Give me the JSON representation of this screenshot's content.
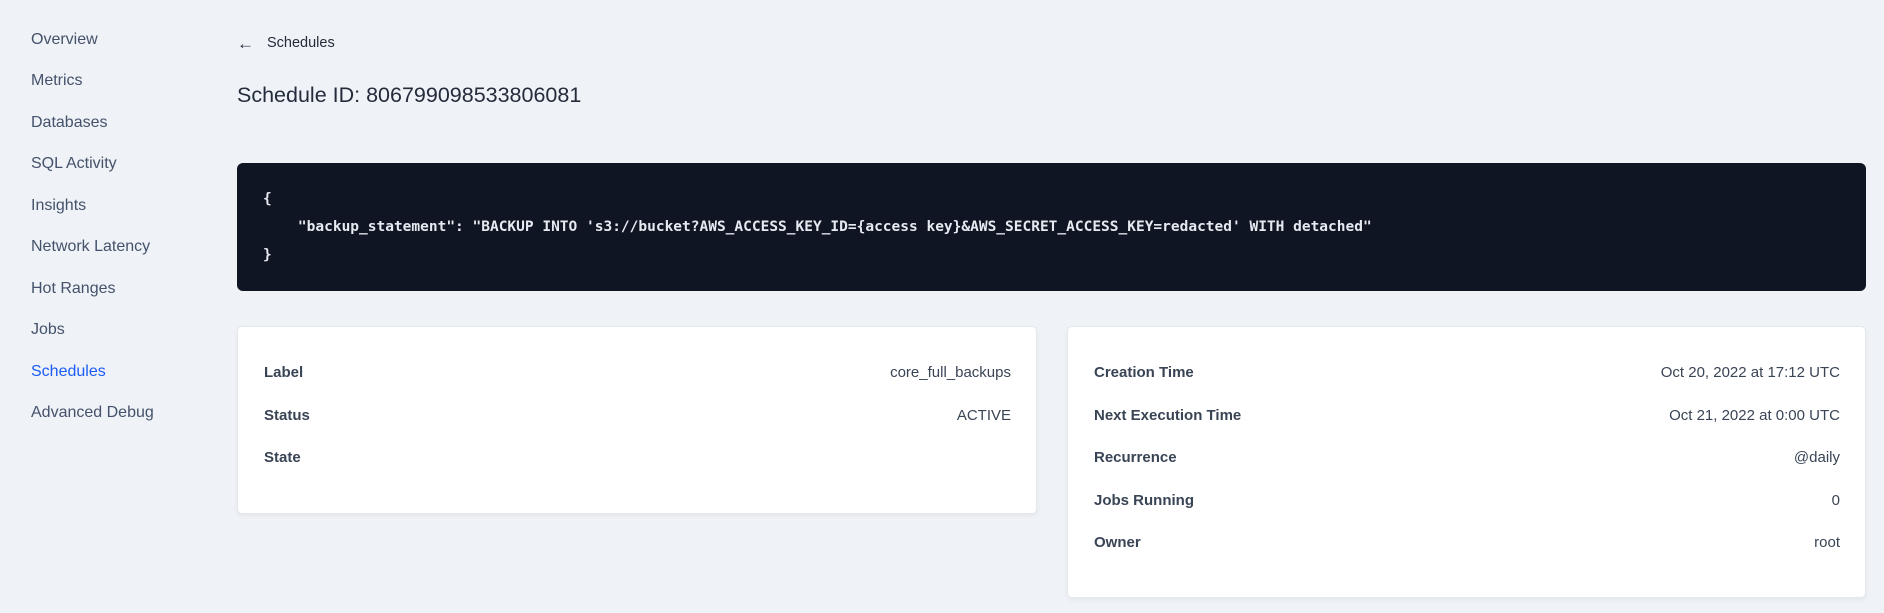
{
  "colors": {
    "page_background": "#eff2f6",
    "accent_blue": "#1a5bf6",
    "code_background": "#101523",
    "code_text": "#e5e9f0",
    "card_background": "#ffffff",
    "text_dark": "#242c3c",
    "text_slate": "#394455"
  },
  "icons": {
    "back_arrow": "←"
  },
  "sidebar": {
    "items": [
      {
        "label": "Overview",
        "active": false
      },
      {
        "label": "Metrics",
        "active": false
      },
      {
        "label": "Databases",
        "active": false
      },
      {
        "label": "SQL Activity",
        "active": false
      },
      {
        "label": "Insights",
        "active": false
      },
      {
        "label": "Network Latency",
        "active": false
      },
      {
        "label": "Hot Ranges",
        "active": false
      },
      {
        "label": "Jobs",
        "active": false
      },
      {
        "label": "Schedules",
        "active": true
      },
      {
        "label": "Advanced Debug",
        "active": false
      }
    ]
  },
  "header": {
    "back_label": "Schedules",
    "title": "Schedule ID: 806799098533806081"
  },
  "code_block": {
    "lines": [
      "{",
      "    \"backup_statement\": \"BACKUP INTO 's3://bucket?AWS_ACCESS_KEY_ID={access key}&AWS_SECRET_ACCESS_KEY=redacted' WITH detached\"",
      "}"
    ]
  },
  "label_card": {
    "rows": [
      {
        "label": "Label",
        "value": "core_full_backups"
      },
      {
        "label": "Status",
        "value": "ACTIVE"
      },
      {
        "label": "State",
        "value": ""
      }
    ]
  },
  "meta_card": {
    "rows": [
      {
        "label": "Creation Time",
        "value": "Oct 20, 2022 at 17:12 UTC"
      },
      {
        "label": "Next Execution Time",
        "value": "Oct 21, 2022 at 0:00 UTC"
      },
      {
        "label": "Recurrence",
        "value": "@daily"
      },
      {
        "label": "Jobs Running",
        "value": "0"
      },
      {
        "label": "Owner",
        "value": "root"
      }
    ]
  }
}
